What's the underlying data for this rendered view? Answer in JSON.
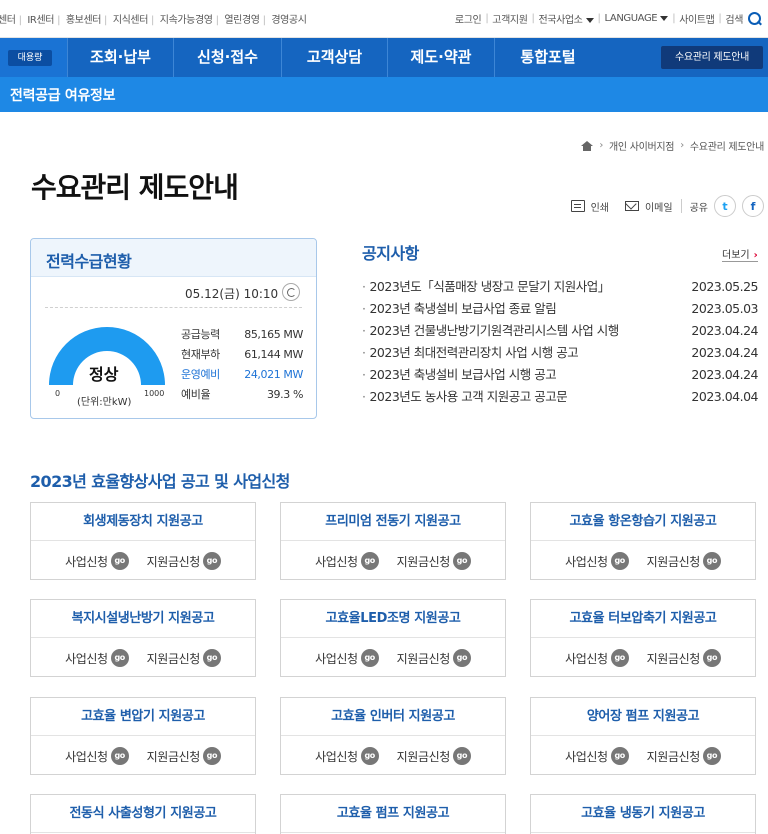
{
  "topbar": {
    "left_links": [
      "센터",
      "IR센터",
      "홍보센터",
      "지식센터",
      "지속가능경영",
      "열린경영",
      "경영공시"
    ],
    "login": "로그인",
    "support": "고객지원",
    "offices": "전국사업소",
    "language": "LANGUAGE",
    "sitemap": "사이트맵",
    "search": "검색"
  },
  "nav": {
    "big_button": "대용량",
    "menus": [
      "조회·납부",
      "신청·접수",
      "고객상담",
      "제도·약관",
      "통합포털"
    ],
    "guide_button": "수요관리 제도안내"
  },
  "subbar": {
    "title": "전력공급 여유정보"
  },
  "breadcrumb": {
    "items": [
      "개인 사이버지점",
      "수요관리 제도안내"
    ]
  },
  "page": {
    "title": "수요관리 제도안내"
  },
  "share": {
    "print": "인쇄",
    "email": "이메일",
    "share": "공유",
    "twitter": "t",
    "facebook": "f"
  },
  "power": {
    "title": "전력수급현황",
    "time": "05.12(금) 10:10",
    "status": "정상",
    "gauge_min": "0",
    "gauge_max": "1000",
    "gauge_unit": "(단위:만kW)",
    "gauge_level": 1.0,
    "stats": [
      {
        "label": "공급능력",
        "value": "85,165 MW",
        "highlight": false
      },
      {
        "label": "현재부하",
        "value": "61,144 MW",
        "highlight": false
      },
      {
        "label": "운영예비",
        "value": "24,021 MW",
        "highlight": true
      },
      {
        "label": "예비율",
        "value": "39.3 %",
        "highlight": false
      }
    ],
    "colors": {
      "gauge": "#1e9bf0",
      "accent": "#1e73d6"
    }
  },
  "notice": {
    "title": "공지사항",
    "more": "더보기",
    "items": [
      {
        "title": "2023년도「식품매장 냉장고 문달기 지원사업」",
        "date": "2023.05.25"
      },
      {
        "title": "2023년 축냉설비 보급사업 종료 알림",
        "date": "2023.05.03"
      },
      {
        "title": "2023년 건물냉난방기기원격관리시스템 사업 시행",
        "date": "2023.04.24"
      },
      {
        "title": "2023년 최대전력관리장치 사업 시행 공고",
        "date": "2023.04.24"
      },
      {
        "title": "2023년 축냉설비 보급사업 시행 공고",
        "date": "2023.04.24"
      },
      {
        "title": "2023년도 농사용 고객 지원공고 공고문",
        "date": "2023.04.04"
      }
    ]
  },
  "programs": {
    "title": "2023년 효율향상사업 공고 및 사업신청",
    "apply_label": "사업신청",
    "subsidy_label": "지원금신청",
    "go_label": "go",
    "cards": [
      "회생제동장치 지원공고",
      "프리미엄 전동기 지원공고",
      "고효율 항온항습기 지원공고",
      "복지시설냉난방기 지원공고",
      "고효율LED조명 지원공고",
      "고효율 터보압축기 지원공고",
      "고효율 변압기 지원공고",
      "고효율 인버터 지원공고",
      "양어장 펌프 지원공고",
      "전동식 사출성형기 지원공고",
      "고효율 펌프 지원공고",
      "고효율 냉동기 지원공고"
    ]
  }
}
